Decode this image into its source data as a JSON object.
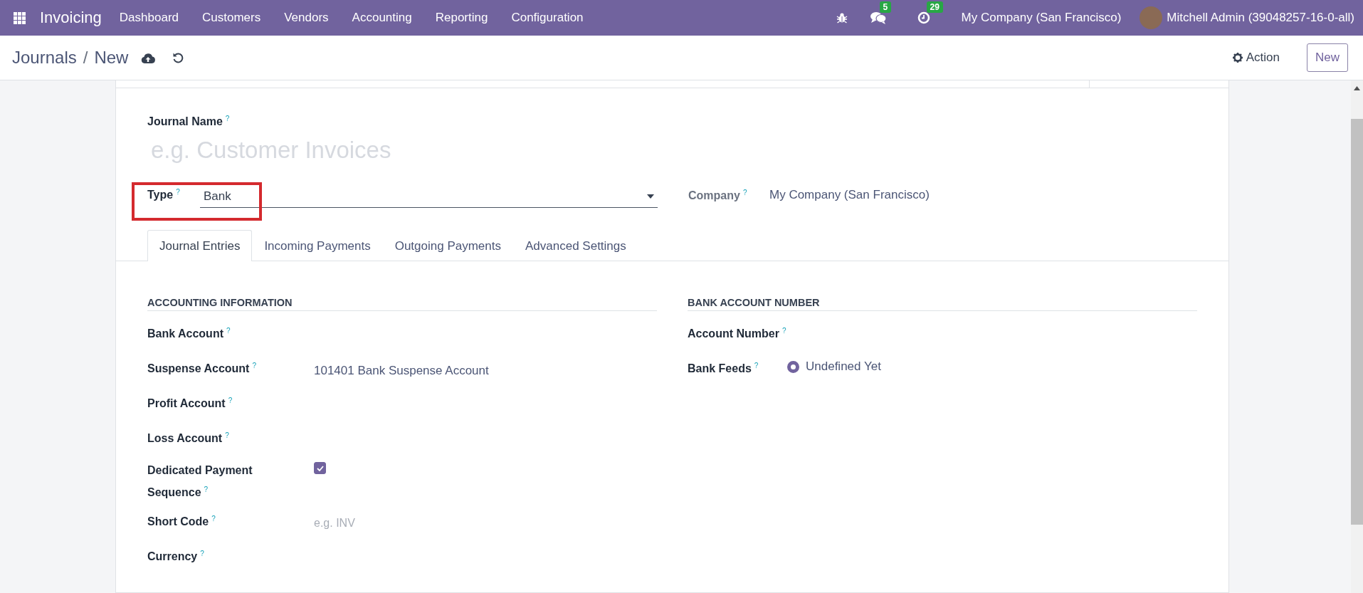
{
  "navbar": {
    "app_name": "Invoicing",
    "menu": [
      "Dashboard",
      "Customers",
      "Vendors",
      "Accounting",
      "Reporting",
      "Configuration"
    ],
    "message_count": "5",
    "activity_count": "29",
    "company": "My Company (San Francisco)",
    "user": "Mitchell Admin (39048257-16-0-all)"
  },
  "control_panel": {
    "breadcrumb_parent": "Journals",
    "breadcrumb_separator": "/",
    "breadcrumb_current": "New",
    "action_button": "Action",
    "new_button": "New"
  },
  "form": {
    "journal_name": {
      "label": "Journal Name",
      "help": "?",
      "placeholder": "e.g. Customer Invoices"
    },
    "type": {
      "label": "Type",
      "help": "?",
      "value": "Bank",
      "highlighted": true
    },
    "company": {
      "label": "Company",
      "help": "?",
      "value": "My Company (San Francisco)"
    },
    "tabs": [
      {
        "label": "Journal Entries",
        "selected": true
      },
      {
        "label": "Incoming Payments",
        "selected": false
      },
      {
        "label": "Outgoing Payments",
        "selected": false
      },
      {
        "label": "Advanced Settings",
        "selected": false
      }
    ],
    "sections": [
      {
        "title": "ACCOUNTING INFORMATION",
        "fields": [
          {
            "label": "Bank Account",
            "help": "?",
            "kind": "empty"
          },
          {
            "label": "Suspense Account",
            "help": "?",
            "kind": "text",
            "value": "101401 Bank Suspense Account"
          },
          {
            "label": "Profit Account",
            "help": "?",
            "kind": "empty"
          },
          {
            "label": "Loss Account",
            "help": "?",
            "kind": "empty"
          },
          {
            "label": "Dedicated Payment Sequence",
            "help": "?",
            "kind": "checkbox",
            "checked": true
          },
          {
            "label": "Short Code",
            "help": "?",
            "kind": "input",
            "placeholder": "e.g. INV"
          },
          {
            "label": "Currency",
            "help": "?",
            "kind": "empty"
          }
        ]
      },
      {
        "title": "BANK ACCOUNT NUMBER",
        "fields": [
          {
            "label": "Account Number",
            "help": "?",
            "kind": "empty"
          },
          {
            "label": "Bank Feeds",
            "help": "?",
            "kind": "radio",
            "option": "Undefined Yet",
            "selected": true
          }
        ]
      }
    ]
  }
}
